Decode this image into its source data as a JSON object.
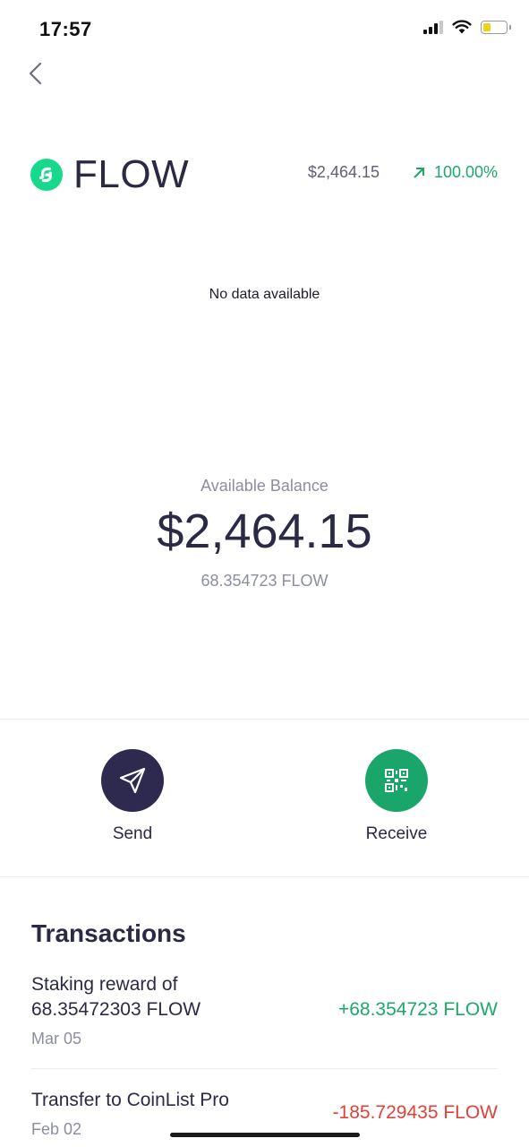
{
  "status_bar": {
    "time": "17:57"
  },
  "asset": {
    "symbol": "FLOW",
    "price": "$2,464.15",
    "change": "100.00%",
    "colors": {
      "logo": "#16d98c",
      "positive": "#1da86a",
      "negative": "#e0413a"
    }
  },
  "chart": {
    "empty_message": "No data available"
  },
  "balance": {
    "label": "Available Balance",
    "value": "$2,464.15",
    "amount": "68.354723 FLOW"
  },
  "actions": {
    "send": {
      "label": "Send",
      "icon": "send-icon",
      "color": "#2e2a4f"
    },
    "receive": {
      "label": "Receive",
      "icon": "qr-code-icon",
      "color": "#1aa56a"
    }
  },
  "transactions": {
    "title": "Transactions",
    "items": [
      {
        "description": "Staking reward of 68.35472303 FLOW",
        "date": "Mar 05",
        "amount": "+68.354723 FLOW",
        "direction": "in"
      },
      {
        "description": "Transfer to CoinList Pro",
        "date": "Feb 02",
        "amount": "-185.729435 FLOW",
        "direction": "out"
      }
    ]
  }
}
